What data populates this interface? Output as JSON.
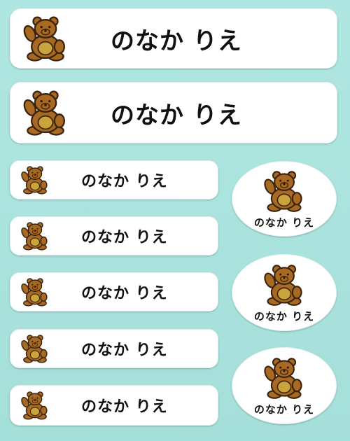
{
  "sheet": {
    "background_color": "#a9e2dd",
    "label_color": "#ffffff",
    "bear_icon": "teddy-bear-icon",
    "bear_colors": {
      "body": "#a86a22",
      "outline": "#3b230c",
      "belly": "#c9a43a"
    }
  },
  "labels": {
    "large": [
      {
        "name_text": "のなか りえ"
      },
      {
        "name_text": "のなか りえ"
      }
    ],
    "small": [
      {
        "name_text": "のなか りえ"
      },
      {
        "name_text": "のなか りえ"
      },
      {
        "name_text": "のなか りえ"
      },
      {
        "name_text": "のなか りえ"
      },
      {
        "name_text": "のなか りえ"
      }
    ],
    "oval": [
      {
        "name_text": "のなか りえ"
      },
      {
        "name_text": "のなか りえ"
      },
      {
        "name_text": "のなか りえ"
      }
    ]
  }
}
